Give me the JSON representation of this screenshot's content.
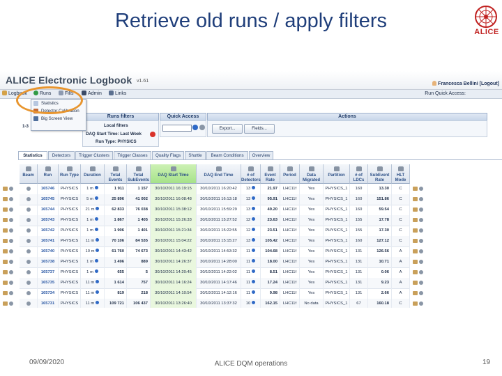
{
  "slide": {
    "title": "Retrieve old runs / apply filters",
    "logo_text": "ALICE",
    "footer_date": "09/09/2020",
    "footer_center": "ALICE DQM operations",
    "page_number": "19"
  },
  "app": {
    "title": "ALICE Electronic Logbook",
    "version": "v1.61",
    "user": "Francesca Bellini [Logout]"
  },
  "menu": {
    "items": [
      "Logbook",
      "Runs",
      "Fills",
      "Admin",
      "Links"
    ],
    "quick_access_label": "Run Quick Access:"
  },
  "dropdown": {
    "items": [
      "Statistics",
      "Detector Calibration",
      "Big Screen View"
    ]
  },
  "panels": {
    "runs_filters_title": "Runs filters",
    "quick_access_title": "Quick Access",
    "actions_title": "Actions",
    "page_indicator": "1-3",
    "local_filters_label": "Local filters",
    "daq_start_label": "DAQ Start Time: Last Week",
    "run_type_label": "Run Type: PHYSICS",
    "export_label": "Export...",
    "fields_label": "Fields..."
  },
  "tabs": [
    "Statistics",
    "Detectors",
    "Trigger Clusters",
    "Trigger Classes",
    "Quality Flags",
    "Shuttle",
    "Beam Conditions",
    "Overview"
  ],
  "colors": {
    "title_blue": "#1f3e7a",
    "alice_red": "#c0201f",
    "highlight_orange": "#e8952e",
    "header_green": "#a6e28a"
  },
  "table": {
    "headers": [
      "Beam",
      "Run",
      "Run Type",
      "Duration",
      "Total Events",
      "Total SubEvents",
      "DAQ Start Time",
      "DAQ End Time",
      "# of Detectors",
      "Event Rate",
      "Period",
      "Data Migrated",
      "Partition",
      "# of LDCs",
      "SubEvent Rate",
      "HLT Mode"
    ],
    "rows": [
      [
        "165746",
        "PHYSICS",
        "1 m",
        "1 911",
        "1 157",
        "30/10/2011 16:19:15",
        "30/10/2011 16:20:42",
        "13",
        "21.97",
        "LHC11f",
        "Yes",
        "PHYSICS_1",
        "160",
        "13.30",
        "C"
      ],
      [
        "165745",
        "PHYSICS",
        "5 m",
        "25 896",
        "41 002",
        "30/10/2011 16:08:48",
        "30/10/2011 16:13:18",
        "13",
        "95.91",
        "LHC11f",
        "Yes",
        "PHYSICS_1",
        "160",
        "151.86",
        "C"
      ],
      [
        "165744",
        "PHYSICS",
        "21 m",
        "62 833",
        "76 038",
        "30/10/2011 15:38:12",
        "30/10/2011 15:59:29",
        "13",
        "49.20",
        "LHC11f",
        "Yes",
        "PHYSICS_1",
        "160",
        "59.54",
        "C"
      ],
      [
        "165743",
        "PHYSICS",
        "1 m",
        "1 867",
        "1 405",
        "30/10/2011 15:26:33",
        "30/10/2011 15:27:52",
        "12",
        "23.63",
        "LHC11f",
        "Yes",
        "PHYSICS_1",
        "155",
        "17.78",
        "C"
      ],
      [
        "165742",
        "PHYSICS",
        "1 m",
        "1 906",
        "1 401",
        "30/10/2011 15:21:34",
        "30/10/2011 15:22:55",
        "12",
        "23.51",
        "LHC11f",
        "Yes",
        "PHYSICS_1",
        "155",
        "17.30",
        "C"
      ],
      [
        "165741",
        "PHYSICS",
        "11 m",
        "70 106",
        "84 535",
        "30/10/2011 15:04:22",
        "30/10/2011 15:15:27",
        "13",
        "105.42",
        "LHC11f",
        "Yes",
        "PHYSICS_1",
        "160",
        "127.12",
        "C"
      ],
      [
        "165740",
        "PHYSICS",
        "10 m",
        "61 760",
        "74 673",
        "30/10/2011 14:43:42",
        "30/10/2011 14:53:32",
        "11",
        "104.68",
        "LHC11f",
        "Yes",
        "PHYSICS_1",
        "131",
        "126.56",
        "A"
      ],
      [
        "165738",
        "PHYSICS",
        "1 m",
        "1 496",
        "889",
        "30/10/2011 14:26:37",
        "30/10/2011 14:28:00",
        "11",
        "18.00",
        "LHC11f",
        "Yes",
        "PHYSICS_1",
        "131",
        "10.71",
        "A"
      ],
      [
        "165737",
        "PHYSICS",
        "1 m",
        "655",
        "5",
        "30/10/2011 14:20:45",
        "30/10/2011 14:22:02",
        "11",
        "8.51",
        "LHC11f",
        "Yes",
        "PHYSICS_1",
        "131",
        "0.06",
        "A"
      ],
      [
        "165735",
        "PHYSICS",
        "11 m",
        "1 614",
        "757",
        "30/10/2011 14:16:24",
        "30/10/2011 14:17:46",
        "11",
        "17.24",
        "LHC11f",
        "Yes",
        "PHYSICS_1",
        "131",
        "9.23",
        "A"
      ],
      [
        "165734",
        "PHYSICS",
        "11 m",
        "819",
        "218",
        "30/10/2011 14:10:54",
        "30/10/2011 14:12:16",
        "11",
        "9.98",
        "LHC11f",
        "Yes",
        "PHYSICS_1",
        "131",
        "2.66",
        "A"
      ],
      [
        "165731",
        "PHYSICS",
        "11 m",
        "109 721",
        "106 437",
        "30/10/2011 13:26:40",
        "30/10/2011 13:37:32",
        "10",
        "162.15",
        "LHC11f",
        "No data",
        "PHYSICS_1",
        "67",
        "160.18",
        "C"
      ]
    ]
  }
}
